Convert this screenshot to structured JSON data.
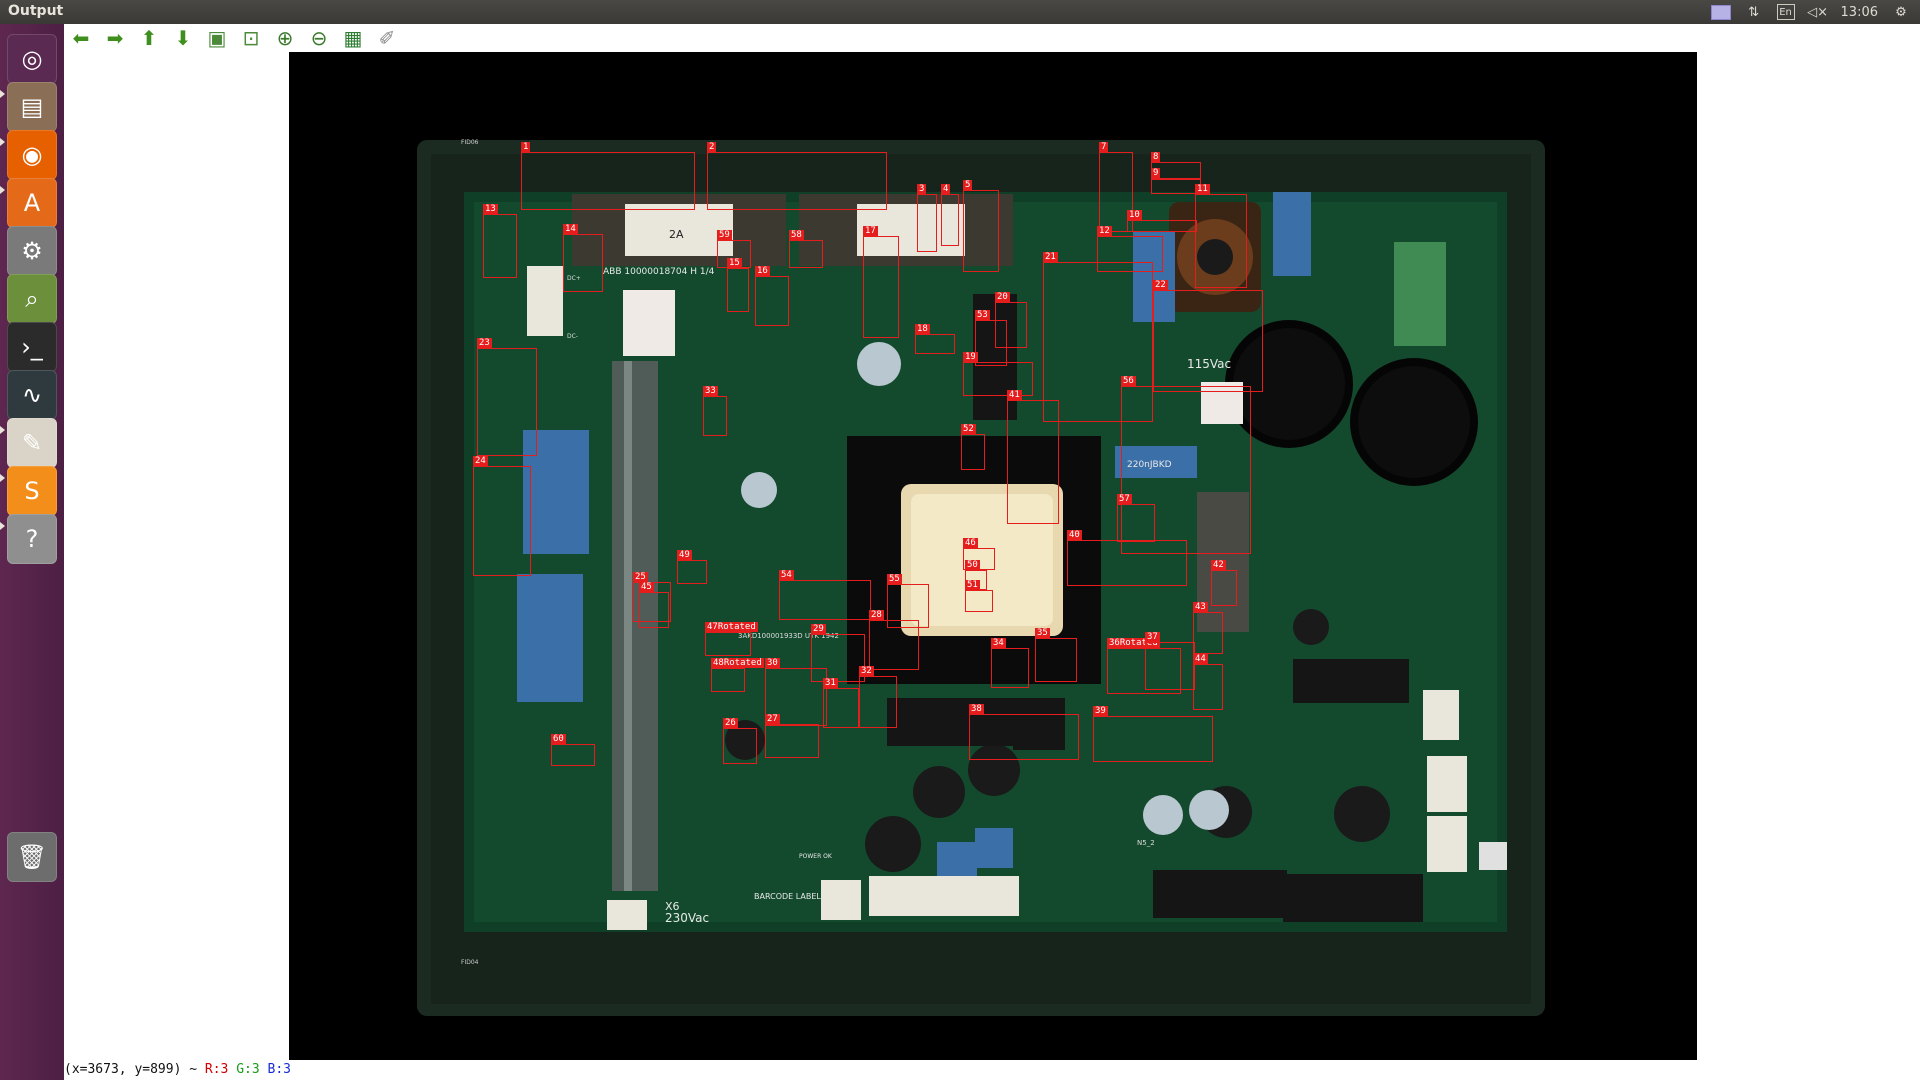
{
  "window": {
    "title": "Output"
  },
  "tray": {
    "keyboard": "En",
    "clock": "13:06"
  },
  "launcher": {
    "items": [
      {
        "name": "ubuntu-dash-icon",
        "glyph": "◎",
        "bg": "#5b2a52"
      },
      {
        "name": "files-icon",
        "glyph": "▤",
        "bg": "#8a6e55"
      },
      {
        "name": "firefox-icon",
        "glyph": "◉",
        "bg": "#e66000"
      },
      {
        "name": "software-center-icon",
        "glyph": "A",
        "bg": "#e46a1a"
      },
      {
        "name": "system-settings-icon",
        "glyph": "⚙",
        "bg": "#7a7a7a"
      },
      {
        "name": "image-viewer-icon",
        "glyph": "⌕",
        "bg": "#6b8f3b"
      },
      {
        "name": "terminal-icon",
        "glyph": "›_",
        "bg": "#2b2b2b"
      },
      {
        "name": "system-monitor-icon",
        "glyph": "∿",
        "bg": "#2f3a3f"
      },
      {
        "name": "text-editor-icon",
        "glyph": "✎",
        "bg": "#d9d4c7"
      },
      {
        "name": "sublime-text-icon",
        "glyph": "S",
        "bg": "#f38e1b"
      },
      {
        "name": "help-icon",
        "glyph": "?",
        "bg": "#8f8f8f"
      },
      {
        "name": "trash-icon",
        "glyph": "🗑",
        "bg": "#6d6d6d"
      }
    ]
  },
  "toolbar": [
    {
      "name": "back-arrow-icon",
      "glyph": "⬅",
      "color": "#3f8f1f"
    },
    {
      "name": "forward-arrow-icon",
      "glyph": "➡",
      "color": "#3f8f1f"
    },
    {
      "name": "up-arrow-icon",
      "glyph": "⬆",
      "color": "#3f8f1f"
    },
    {
      "name": "down-arrow-icon",
      "glyph": "⬇",
      "color": "#3f8f1f"
    },
    {
      "name": "image-icon",
      "glyph": "▣",
      "color": "#4c8a3a"
    },
    {
      "name": "fit-window-icon",
      "glyph": "⊡",
      "color": "#4c8a3a"
    },
    {
      "name": "zoom-in-icon",
      "glyph": "⊕",
      "color": "#3a7a2a"
    },
    {
      "name": "zoom-out-icon",
      "glyph": "⊖",
      "color": "#3a7a2a"
    },
    {
      "name": "save-icon",
      "glyph": "▦",
      "color": "#2e7d32"
    },
    {
      "name": "brush-icon",
      "glyph": "✐",
      "color": "#8a8a8a"
    }
  ],
  "detections": [
    {
      "label": "1"
    },
    {
      "label": "2"
    },
    {
      "label": "3"
    },
    {
      "label": "4"
    },
    {
      "label": "5"
    },
    {
      "label": "7"
    },
    {
      "label": "8"
    },
    {
      "label": "9"
    },
    {
      "label": "10"
    },
    {
      "label": "11"
    },
    {
      "label": "12"
    },
    {
      "label": "13"
    },
    {
      "label": "14"
    },
    {
      "label": "15"
    },
    {
      "label": "16"
    },
    {
      "label": "17"
    },
    {
      "label": "18"
    },
    {
      "label": "19"
    },
    {
      "label": "20"
    },
    {
      "label": "21"
    },
    {
      "label": "22"
    },
    {
      "label": "23"
    },
    {
      "label": "24"
    },
    {
      "label": "25"
    },
    {
      "label": "26"
    },
    {
      "label": "27"
    },
    {
      "label": "28"
    },
    {
      "label": "29"
    },
    {
      "label": "30"
    },
    {
      "label": "31"
    },
    {
      "label": "32"
    },
    {
      "label": "33"
    },
    {
      "label": "34"
    },
    {
      "label": "35"
    },
    {
      "label": "36Rotated"
    },
    {
      "label": "37"
    },
    {
      "label": "38"
    },
    {
      "label": "39"
    },
    {
      "label": "40"
    },
    {
      "label": "41"
    },
    {
      "label": "42"
    },
    {
      "label": "43"
    },
    {
      "label": "44"
    },
    {
      "label": "45"
    },
    {
      "label": "46"
    },
    {
      "label": "47Rotated"
    },
    {
      "label": "48Rotated"
    },
    {
      "label": "49"
    },
    {
      "label": "50"
    },
    {
      "label": "51"
    },
    {
      "label": "52"
    },
    {
      "label": "53"
    },
    {
      "label": "54"
    },
    {
      "label": "55"
    },
    {
      "label": "56"
    },
    {
      "label": "57"
    },
    {
      "label": "58"
    },
    {
      "label": "59"
    },
    {
      "label": "60"
    },
    {
      "label": "25Rotated"
    }
  ],
  "board_text": {
    "part_number": "ABB 10000018704  H 1/4",
    "volt_115": "115Vac",
    "volt_230": "230Vac",
    "connector": "X6",
    "barcode_label": "BARCODE LABEL",
    "power_ok": "POWER OK",
    "cap_220": "220nJBKD",
    "fuse_2a": "2A",
    "fid_top": "FID06",
    "fid_bottom": "FID04",
    "trafo_label": "3AKD100001933D UTK 1942",
    "n5": "N5_2",
    "dc_plus": "DC+",
    "dc_minus": "DC-"
  },
  "status": {
    "coords": "(x=3673, y=899) ~",
    "r": "R:3",
    "g": "G:3",
    "b": "B:3",
    "r_color": "#d40000",
    "g_color": "#1a9a1a",
    "b_color": "#1a2ad4"
  }
}
